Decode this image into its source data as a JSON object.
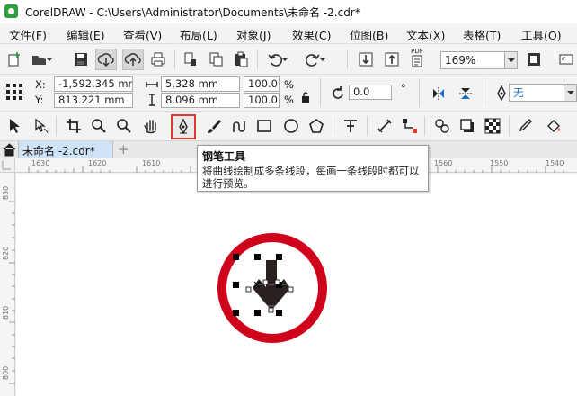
{
  "window": {
    "title": "CorelDRAW - C:\\Users\\Administrator\\Documents\\未命名 -2.cdr*"
  },
  "menu": [
    {
      "label": "文件(F)"
    },
    {
      "label": "编辑(E)"
    },
    {
      "label": "查看(V)"
    },
    {
      "label": "布局(L)"
    },
    {
      "label": "对象(J)"
    },
    {
      "label": "效果(C)"
    },
    {
      "label": "位图(B)"
    },
    {
      "label": "文本(X)"
    },
    {
      "label": "表格(T)"
    },
    {
      "label": "工具(O)"
    }
  ],
  "toolbar": {
    "zoom": "169%",
    "pdf_label": "PDF"
  },
  "props": {
    "x_label": "X:",
    "y_label": "Y:",
    "x": "-1,592.345 mm",
    "y": "813.221 mm",
    "w": "5.328 mm",
    "h": "8.096 mm",
    "scale_w": "100.0",
    "scale_h": "100.0",
    "pct": "%",
    "rotation": "0.0",
    "rotation_unit": "°",
    "outline": "无"
  },
  "tabs": [
    {
      "label": "未命名 -2.cdr*"
    }
  ],
  "rulers": {
    "h": [
      "1630",
      "1620",
      "1610",
      "1560",
      "1550",
      "1540"
    ],
    "v": [
      "830",
      "820",
      "810",
      "800"
    ]
  },
  "tooltip": {
    "title": "钢笔工具",
    "desc": "将曲线绘制成多条线段，每画一条线段时都可以进行预览。"
  },
  "colors": {
    "sign_red": "#d0021b",
    "arrow": "#2a211e",
    "active_tool": "#e0382e"
  }
}
